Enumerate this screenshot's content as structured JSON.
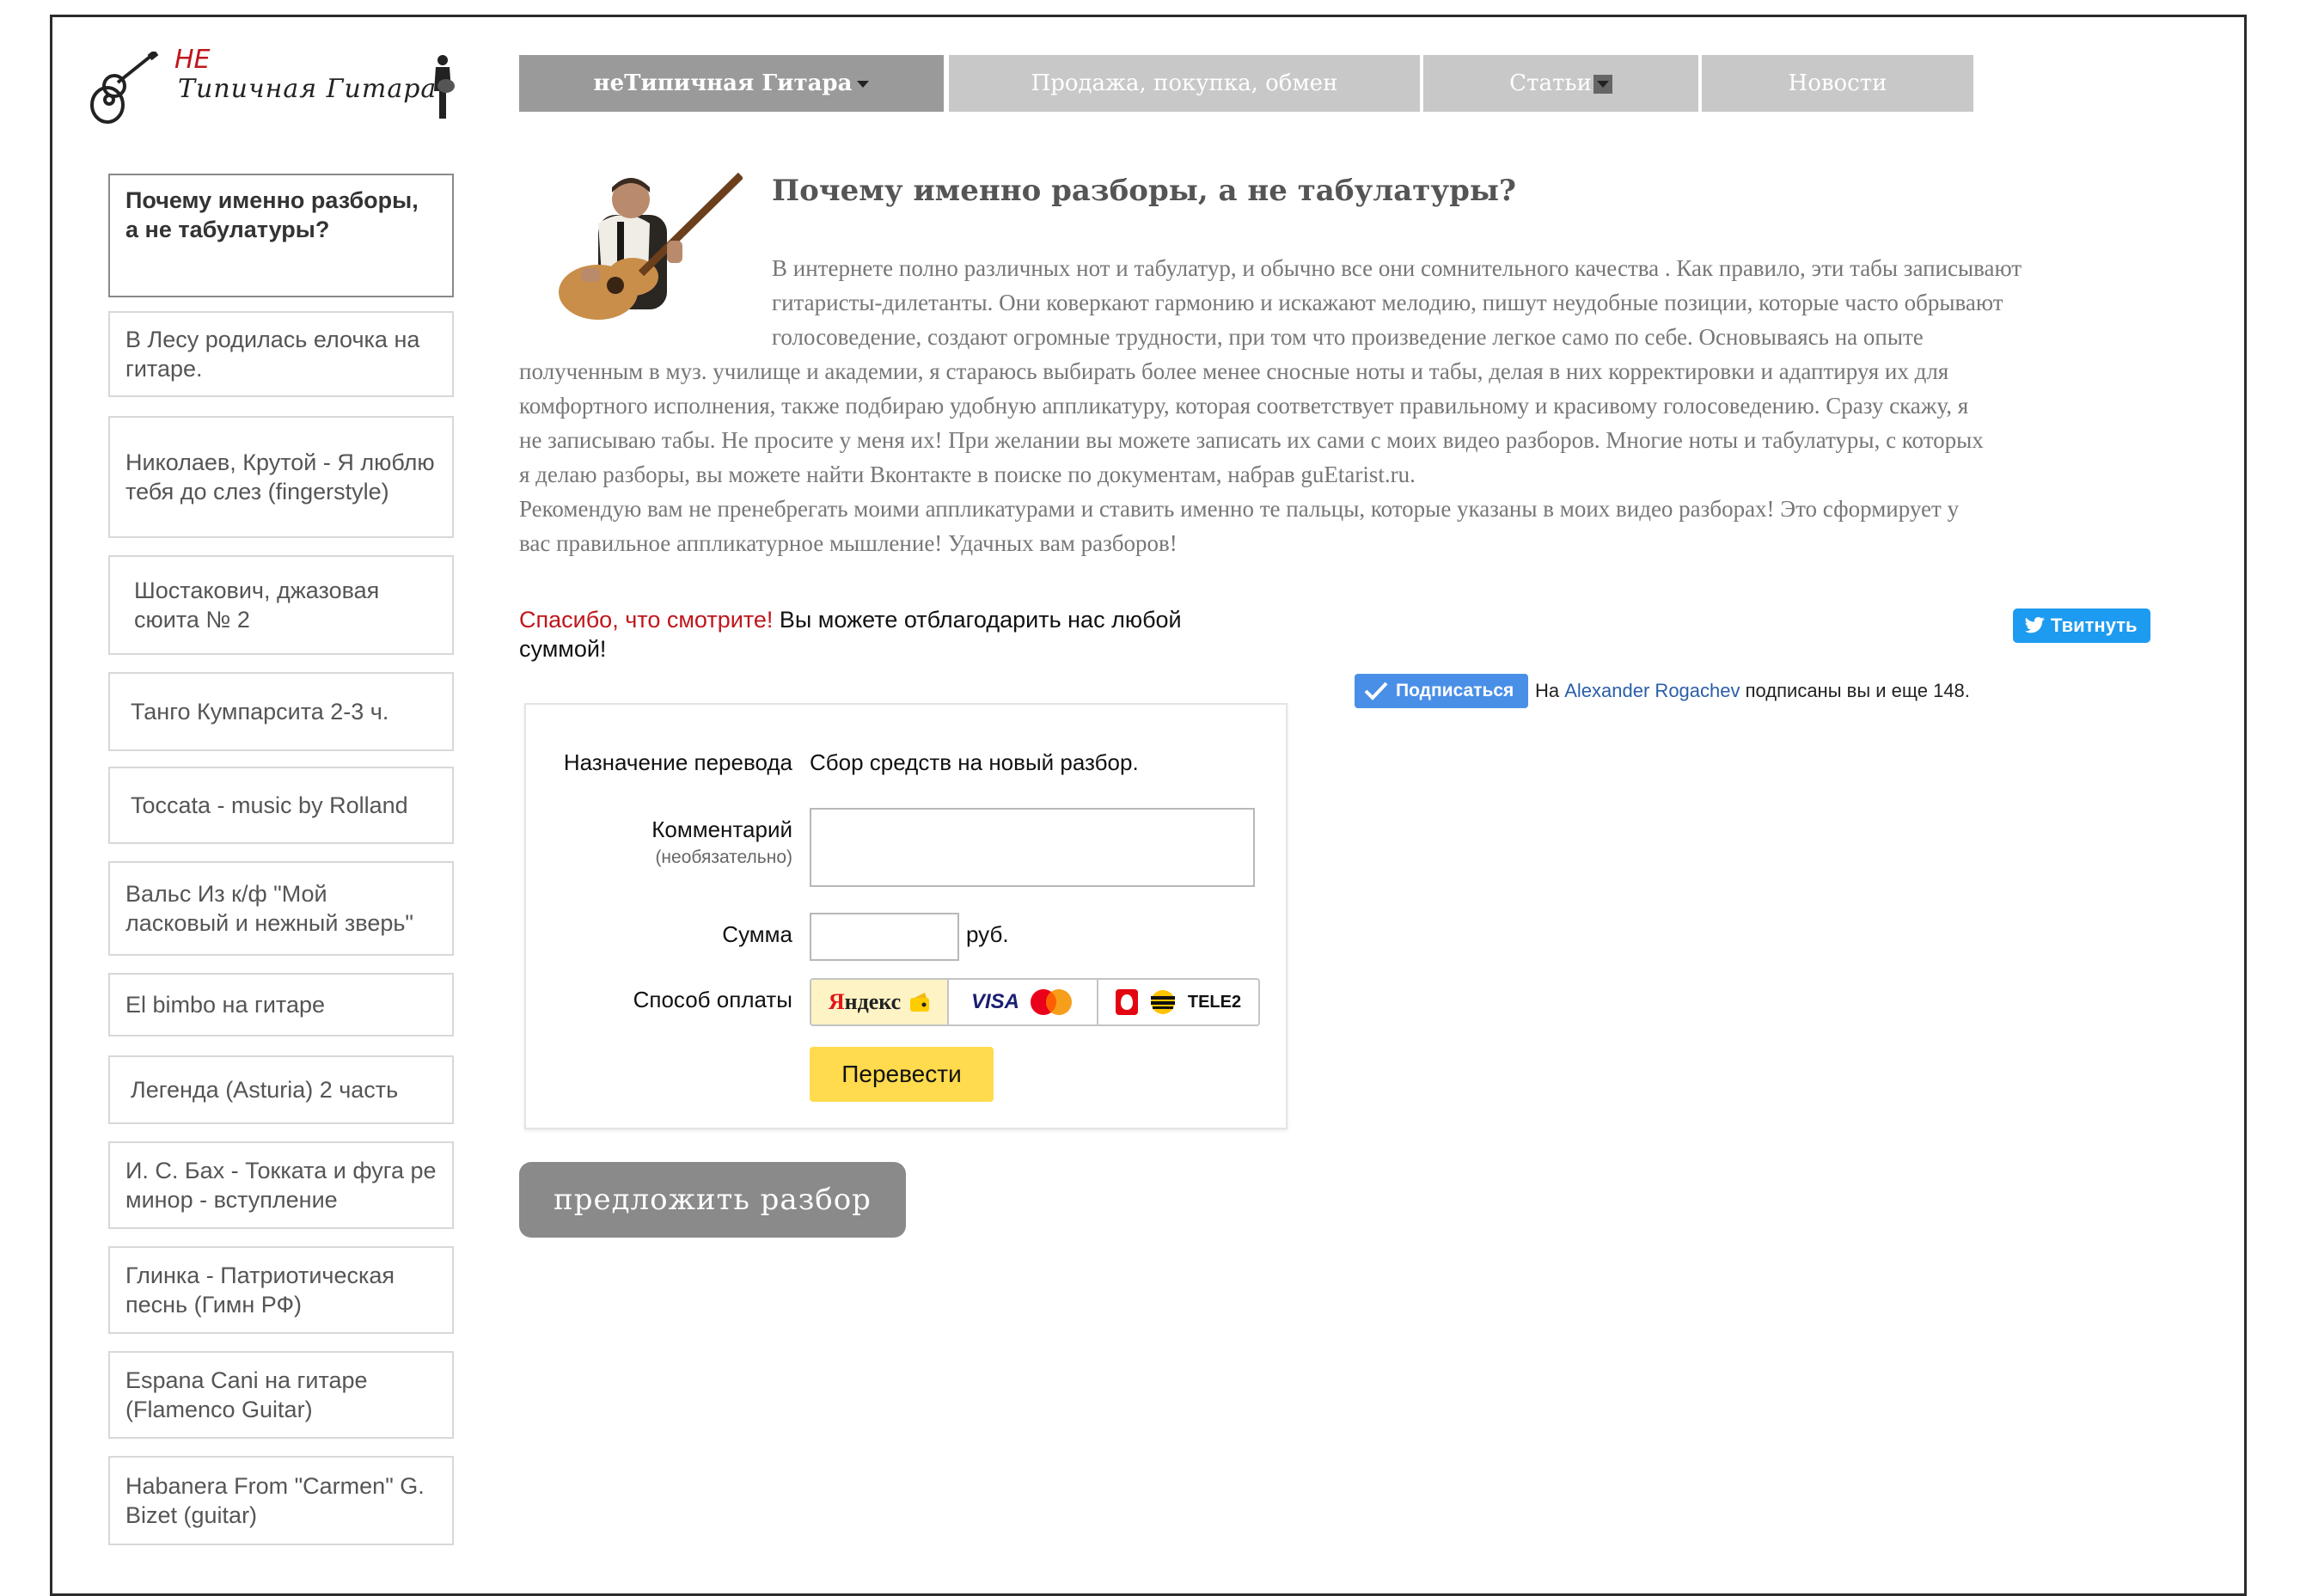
{
  "logo": {
    "ne": "НЕ",
    "word": "Типичная Гитара"
  },
  "nav": [
    {
      "label": "неТипичная Гитара"
    },
    {
      "label": "Продажа, покупка, обмен"
    },
    {
      "label": "Статьи"
    },
    {
      "label": "Новости"
    }
  ],
  "sidebar": {
    "items": [
      {
        "label": "Почему именно разборы, а не табулатуры?"
      },
      {
        "label": "В Лесу родилась елочка на гитаре."
      },
      {
        "label": "Николаев, Крутой - Я люблю тебя до слез (fingerstyle)"
      },
      {
        "label": "Шостакович, джазовая сюита № 2"
      },
      {
        "label": "Танго Кумпарсита 2-3 ч."
      },
      {
        "label": "Toccata - music by Rolland"
      },
      {
        "label": "Вальс Из к/ф \"Мой ласковый и нежный зверь\""
      },
      {
        "label": "El bimbo на гитаре"
      },
      {
        "label": "Легенда (Asturia) 2 часть"
      },
      {
        "label": "И. С. Бах - Токката и фуга ре минор - вступление"
      },
      {
        "label": "Глинка - Патриотическая песнь (Гимн РФ)"
      },
      {
        "label": "Espana Cani на гитаре (Flamenco Guitar)"
      },
      {
        "label": "Habanera From \"Carmen\" G. Bizet (guitar)"
      }
    ]
  },
  "article": {
    "title": "Почему именно разборы, а не табулатуры?",
    "lines": [
      "В интернете полно различных нот и табулатур, и обычно все они сомнительного качества . Как правило, эти табы записывают",
      "гитаристы-дилетанты. Они коверкают гармонию и искажают мелодию, пишут неудобные позиции, которые часто обрывают",
      "голосоведение, создают огромные трудности, при том что произведение легкое само по себе. Основываясь на опыте",
      "полученным в муз. училище и академии, я стараюсь выбирать более менее сносные ноты и табы, делая в них корректировки и адаптируя их для",
      "комфортного исполнения, также подбираю удобную аппликатуру, которая соответствует правильному и красивому голосоведению. Сразу скажу, я",
      "не записываю табы. Не просите у меня их! При желании вы можете записать их сами с моих видео разборов. Многие ноты и табулатуры, с которых",
      "я делаю разборы, вы можете найти Вконтакте в поиске по документам, набрав guEtarist.ru.",
      "Рекомендую вам не пренебрегать моими аппликатурами и ставить именно те пальцы, которые указаны в моих видео разборах! Это сформирует у",
      "вас правильное аппликатурное мышление! Удачных вам разборов!"
    ]
  },
  "thanks": {
    "red": "Спасибо, что смотрите!",
    "rest": " Вы можете отблагодарить нас любой суммой!"
  },
  "share": {
    "tweet_label": "Твитнуть",
    "subscribe_label": "Подписаться",
    "subscribe_prefix": "На ",
    "subscribe_name": "Alexander Rogachev",
    "subscribe_suffix": " подписаны вы и еще 148."
  },
  "form": {
    "purpose_label": "Назначение перевода",
    "purpose_value": "Сбор средств на новый разбор.",
    "comment_label": "Комментарий",
    "comment_sub": "(необязательно)",
    "comment_value": "",
    "sum_label": "Сумма",
    "sum_value": "",
    "sum_unit": "руб.",
    "method_label": "Способ оплаты",
    "methods": [
      {
        "name": "Яндекс",
        "selected": true
      },
      {
        "name": "VISA",
        "selected": false
      },
      {
        "name": "TELE2",
        "selected": false
      }
    ],
    "submit_label": "Перевести"
  },
  "suggest_label": "предложить разбор",
  "colors": {
    "nav_active": "#9a9a9a",
    "nav": "#c8c8c8",
    "accent_red": "#c0161b",
    "submit": "#ffdb4d",
    "suggest": "#8a8a8a",
    "tweet": "#1d9bf0",
    "subscribe": "#4a8fe7"
  }
}
